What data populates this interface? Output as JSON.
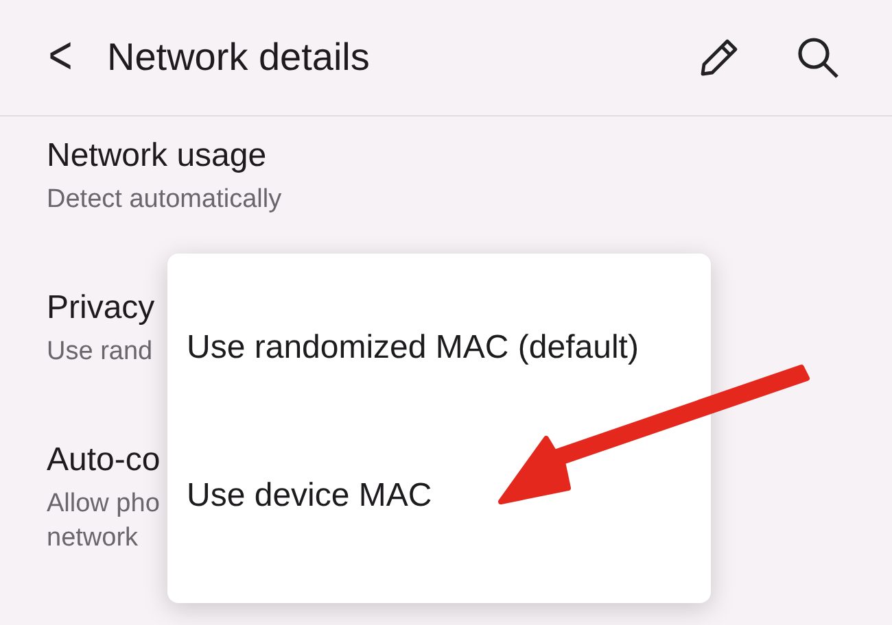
{
  "header": {
    "back_icon": "<",
    "title": "Network details"
  },
  "settings": [
    {
      "title": "Network usage",
      "subtitle_lines": [
        "Detect automatically"
      ]
    },
    {
      "title": "Privacy",
      "subtitle_lines": [
        "Use rand"
      ]
    },
    {
      "title": "Auto-co",
      "subtitle_lines": [
        "Allow pho",
        "network"
      ]
    }
  ],
  "menu": {
    "options": [
      {
        "label": "Use randomized MAC (default)"
      },
      {
        "label": "Use device MAC"
      }
    ]
  }
}
